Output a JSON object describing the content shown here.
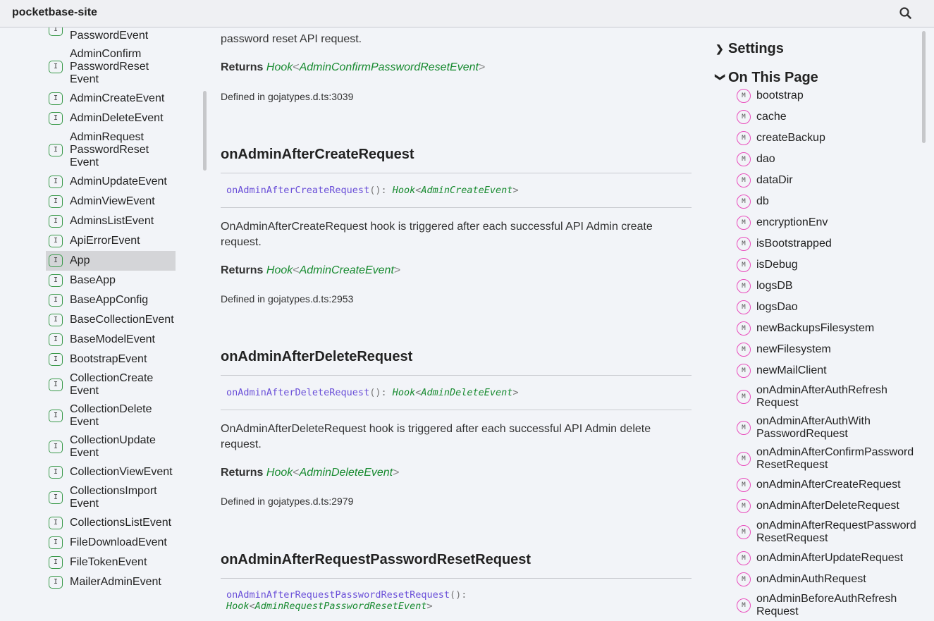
{
  "header": {
    "title": "pocketbase-site",
    "search_icon": "search-icon"
  },
  "left_nav": [
    {
      "lines": [
        "AdminAuthWith",
        "PasswordEvent"
      ]
    },
    {
      "lines": [
        "AdminConfirm",
        "PasswordReset",
        "Event"
      ]
    },
    {
      "lines": [
        "AdminCreateEvent"
      ]
    },
    {
      "lines": [
        "AdminDeleteEvent"
      ]
    },
    {
      "lines": [
        "AdminRequest",
        "PasswordReset",
        "Event"
      ]
    },
    {
      "lines": [
        "AdminUpdateEvent"
      ]
    },
    {
      "lines": [
        "AdminViewEvent"
      ]
    },
    {
      "lines": [
        "AdminsListEvent"
      ]
    },
    {
      "lines": [
        "ApiErrorEvent"
      ]
    },
    {
      "lines": [
        "App"
      ],
      "active": true
    },
    {
      "lines": [
        "BaseApp"
      ]
    },
    {
      "lines": [
        "BaseAppConfig"
      ]
    },
    {
      "lines": [
        "BaseCollectionEvent"
      ]
    },
    {
      "lines": [
        "BaseModelEvent"
      ]
    },
    {
      "lines": [
        "BootstrapEvent"
      ]
    },
    {
      "lines": [
        "CollectionCreate",
        "Event"
      ]
    },
    {
      "lines": [
        "CollectionDelete",
        "Event"
      ]
    },
    {
      "lines": [
        "CollectionUpdate",
        "Event"
      ]
    },
    {
      "lines": [
        "CollectionViewEvent"
      ]
    },
    {
      "lines": [
        "CollectionsImport",
        "Event"
      ]
    },
    {
      "lines": [
        "CollectionsListEvent"
      ]
    },
    {
      "lines": [
        "FileDownloadEvent"
      ]
    },
    {
      "lines": [
        "FileTokenEvent"
      ]
    },
    {
      "lines": [
        "MailerAdminEvent"
      ]
    }
  ],
  "badges": {
    "interface": "I",
    "method": "M"
  },
  "main": {
    "intro_tail": "password reset API request.",
    "returns_label": "Returns",
    "defined_prefix": "Defined in ",
    "first": {
      "hook": "Hook",
      "type": "AdminConfirmPasswordResetEvent",
      "defined": "gojatypes.d.ts:3039"
    },
    "sections": [
      {
        "title": "onAdminAfterCreateRequest",
        "sig_name": "onAdminAfterCreateRequest",
        "sig_parens": "():",
        "hook": "Hook",
        "type": "AdminCreateEvent",
        "desc": "OnAdminAfterCreateRequest hook is triggered after each successful API Admin create request.",
        "defined": "gojatypes.d.ts:2953"
      },
      {
        "title": "onAdminAfterDeleteRequest",
        "sig_name": "onAdminAfterDeleteRequest",
        "sig_parens": "():",
        "hook": "Hook",
        "type": "AdminDeleteEvent",
        "desc": "OnAdminAfterDeleteRequest hook is triggered after each successful API Admin delete request.",
        "defined": "gojatypes.d.ts:2979"
      },
      {
        "title": "onAdminAfterRequestPasswordResetRequest",
        "sig_name": "onAdminAfterRequestPasswordResetRequest",
        "sig_parens": "():",
        "hook": "Hook",
        "type": "AdminRequestPasswordResetEvent"
      }
    ]
  },
  "right": {
    "settings": "Settings",
    "on_this_page": "On This Page",
    "items": [
      [
        "bootstrap"
      ],
      [
        "cache"
      ],
      [
        "createBackup"
      ],
      [
        "dao"
      ],
      [
        "dataDir"
      ],
      [
        "db"
      ],
      [
        "encryptionEnv"
      ],
      [
        "isBootstrapped"
      ],
      [
        "isDebug"
      ],
      [
        "logsDB"
      ],
      [
        "logsDao"
      ],
      [
        "newBackupsFilesystem"
      ],
      [
        "newFilesystem"
      ],
      [
        "newMailClient"
      ],
      [
        "onAdminAfterAuthRefresh",
        "Request"
      ],
      [
        "onAdminAfterAuthWith",
        "PasswordRequest"
      ],
      [
        "onAdminAfterConfirmPassword",
        "ResetRequest"
      ],
      [
        "onAdminAfterCreateRequest"
      ],
      [
        "onAdminAfterDeleteRequest"
      ],
      [
        "onAdminAfterRequestPassword",
        "ResetRequest"
      ],
      [
        "onAdminAfterUpdateRequest"
      ],
      [
        "onAdminAuthRequest"
      ],
      [
        "onAdminBeforeAuthRefresh",
        "Request"
      ]
    ]
  }
}
